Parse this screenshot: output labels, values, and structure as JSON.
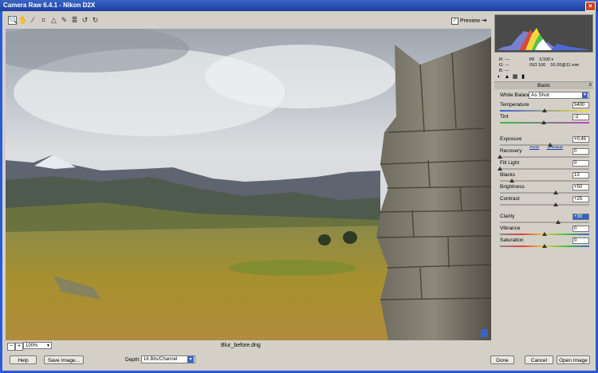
{
  "window": {
    "title": "Camera Raw 6.4.1  -  Nikon D2X",
    "close_glyph": "×"
  },
  "toolbar": {
    "tools": [
      {
        "name": "zoom-tool-icon",
        "glyph": "🔍"
      },
      {
        "name": "hand-tool-icon",
        "glyph": "✋"
      },
      {
        "name": "white-balance-tool-icon",
        "glyph": "⁄"
      },
      {
        "name": "crop-tool-icon",
        "glyph": "⌗"
      },
      {
        "name": "straighten-tool-icon",
        "glyph": "△"
      },
      {
        "name": "spot-removal-tool-icon",
        "glyph": "✎"
      },
      {
        "name": "preferences-icon",
        "glyph": "≣"
      },
      {
        "name": "rotate-left-icon",
        "glyph": "↺"
      },
      {
        "name": "rotate-right-icon",
        "glyph": "↻"
      }
    ],
    "preview_label": "Preview",
    "preview_checked": "✓",
    "fullscreen_glyph": "⇥"
  },
  "status": {
    "zoom": "100%",
    "zoom_minus": "−",
    "zoom_plus": "+",
    "filename": "Blur_before.dng"
  },
  "readout": {
    "r": "R:    ---",
    "g": "G:    ---",
    "b": "B:    ---"
  },
  "camera": {
    "aperture": "f/8",
    "shutter": "1/100 s",
    "iso": "ISO 100",
    "lens": "10-20@11 mm"
  },
  "panel": {
    "title": "Basic",
    "menu_glyph": "≡",
    "white_balance_label": "White Balance:",
    "white_balance_value": "As Shot",
    "auto_link": "Auto",
    "default_link": "Default",
    "sliders": {
      "temperature": {
        "label": "Temperature",
        "value": "5400",
        "pos": 0.5
      },
      "tint": {
        "label": "Tint",
        "value": "-2",
        "pos": 0.49
      },
      "exposure": {
        "label": "Exposure",
        "value": "+0.45",
        "pos": 0.56
      },
      "recovery": {
        "label": "Recovery",
        "value": "0",
        "pos": 0.0
      },
      "fill_light": {
        "label": "Fill Light",
        "value": "0",
        "pos": 0.0
      },
      "blacks": {
        "label": "Blacks",
        "value": "13",
        "pos": 0.13
      },
      "brightness": {
        "label": "Brightness",
        "value": "+50",
        "pos": 0.625
      },
      "contrast": {
        "label": "Contrast",
        "value": "+25",
        "pos": 0.625
      },
      "clarity": {
        "label": "Clarity",
        "value": "+30",
        "pos": 0.65
      },
      "vibrance": {
        "label": "Vibrance",
        "value": "0",
        "pos": 0.5
      },
      "saturation": {
        "label": "Saturation",
        "value": "0",
        "pos": 0.5
      }
    }
  },
  "bottom": {
    "help": "Help",
    "save": "Save Image...",
    "depth_label": "Depth:",
    "depth_value": "16 Bits/Channel",
    "done": "Done",
    "cancel": "Cancel",
    "open": "Open Image"
  }
}
